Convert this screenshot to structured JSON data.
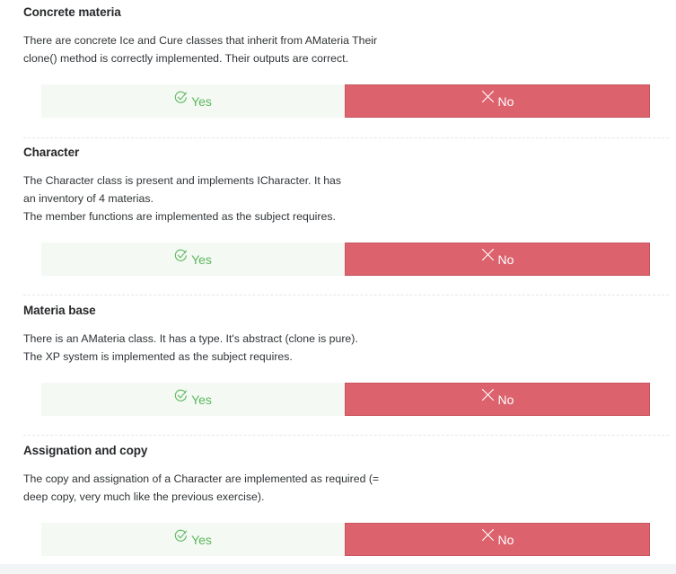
{
  "sections": [
    {
      "title": "Concrete materia",
      "desc": [
        "There are concrete Ice and Cure classes that inherit from AMateria Their",
        "clone() method is correctly implemented. Their outputs are correct."
      ],
      "yes_label": "Yes",
      "no_label": "No"
    },
    {
      "title": "Character",
      "desc": [
        "The Character class is present and implements ICharacter. It has",
        "an inventory of 4 materias.",
        "The member functions are implemented as the subject requires."
      ],
      "yes_label": "Yes",
      "no_label": "No"
    },
    {
      "title": "Materia base",
      "desc": [
        "There is an AMateria class. It has a type. It's abstract (clone is pure).",
        "The XP system is implemented as the subject requires."
      ],
      "yes_label": "Yes",
      "no_label": "No"
    },
    {
      "title": "Assignation and copy",
      "desc": [
        "The copy and assignation of a Character are implemented as required (=",
        "deep copy, very much like the previous exercise)."
      ],
      "yes_label": "Yes",
      "no_label": "No"
    }
  ],
  "icons": {
    "yes": "check-icon",
    "no": "close-icon"
  },
  "colors": {
    "yes_text": "#5cb85c",
    "yes_bg": "#f4f9f4",
    "no_bg": "#dc626d",
    "no_text": "#ffffff"
  }
}
